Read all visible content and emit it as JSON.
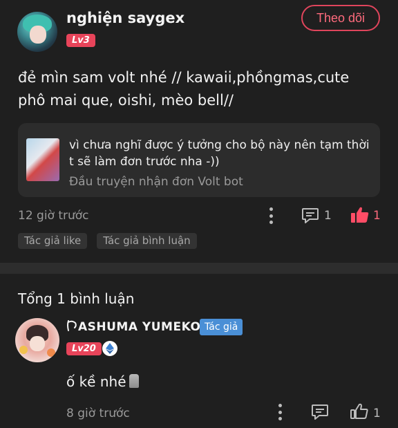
{
  "post": {
    "username": "nghiện saygex",
    "level": "Lv3",
    "follow_label": "Theo dõi",
    "text": "đẻ mìn sam volt nhé // kawaii,phồngmas,cute phô mai que, oishi, mèo bell//",
    "quote": {
      "text": "vì chưa nghĩ được ý tưởng cho bộ này nên tạm thời t sẽ làm đơn trước nha -))",
      "subtitle": "Đầu truyện nhận đơn Volt bot"
    },
    "time": "12 giờ trước",
    "comment_count": "1",
    "like_count": "1",
    "tags": [
      "Tác giả like",
      "Tác giả bình luận"
    ],
    "accent_color": "#e8445a"
  },
  "comments": {
    "title": "Tổng 1 bình luận",
    "items": [
      {
        "name": "ASHUMA YUMEKO",
        "author_badge": "Tác giả",
        "level": "Lv20",
        "text": "ố kề nhé",
        "time": "8 giờ trước",
        "like_count": "1"
      }
    ]
  },
  "icons": {
    "more": "kebab-vertical-icon",
    "comment": "comment-bubble-icon",
    "like": "thumbs-up-icon",
    "badge": "ethereum-diamond-icon",
    "emoji": "moai-emoji"
  }
}
